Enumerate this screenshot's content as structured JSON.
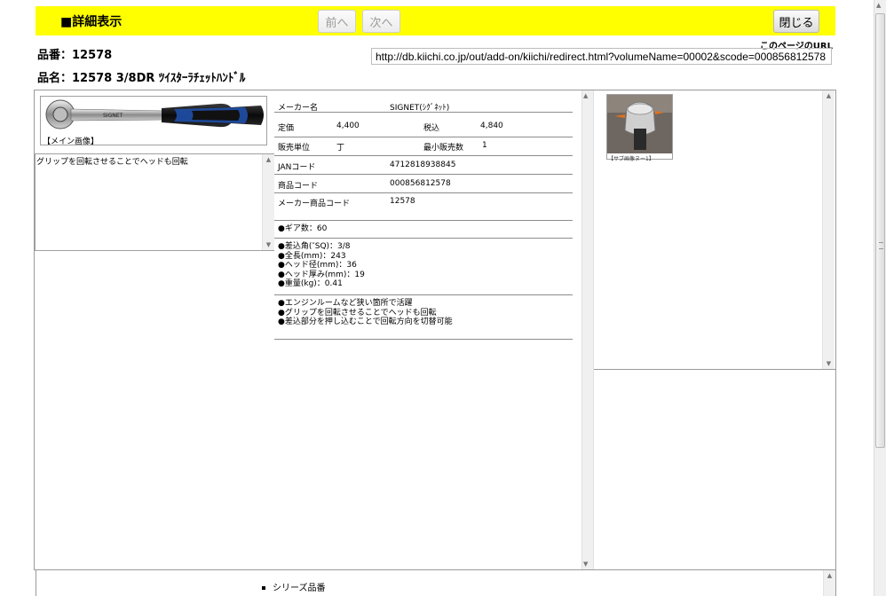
{
  "header": {
    "title": "■詳細表示",
    "prev_label": "前へ",
    "next_label": "次へ",
    "close_label": "閉じる"
  },
  "product": {
    "number_line": "品番：12578",
    "name_line": "品名：12578 3/8DR ﾂｲｽﾀｰﾗﾁｪｯﾄﾊﾝﾄﾞﾙ"
  },
  "page_url": {
    "label": "このページのURL",
    "value": "http://db.kiichi.co.jp/out/add-on/kiichi/redirect.html?volumeName=00002&scode=000856812578"
  },
  "main_image": {
    "caption": "【メイン画像】"
  },
  "description": {
    "text": "グリップを回転させることでヘッドも回転"
  },
  "spec": {
    "maker_label": "メーカー名",
    "maker_value": "SIGNET(ｼｸﾞﾈｯﾄ)",
    "list_price_label": "定価",
    "list_price_value": "4,400",
    "tax_incl_label": "税込",
    "tax_incl_value": "4,840",
    "unit_label": "販売単位",
    "unit_value": "丁",
    "min_qty_label": "最小販売数",
    "min_qty_value": "1",
    "jan_label": "JANコード",
    "jan_value": "4712818938845",
    "product_code_label": "商品コード",
    "product_code_value": "000856812578",
    "maker_code_label": "メーカー商品コード",
    "maker_code_value": "12578"
  },
  "features": {
    "group1": [
      "●ギア数：60"
    ],
    "group2": [
      "●差込角(″SQ)：3/8",
      "●全長(mm)：243",
      "●ヘッド径(mm)：36",
      "●ヘッド厚み(mm)：19",
      "●重量(kg)：0.41"
    ],
    "group3": [
      "●エンジンルームなど狭い箇所で活躍",
      "●グリップを回転させることでヘッドも回転",
      "●差込部分を押し込むことで回転方向を切替可能"
    ]
  },
  "sub_image": {
    "caption": "【サブ画像ヌー1】"
  },
  "series": {
    "label": "シリーズ品番"
  },
  "colors": {
    "header_bg": "#ffff00",
    "grip_blue": "#1f4fa8"
  },
  "icons": [
    "scroll-up-arrow",
    "scroll-down-arrow",
    "ratchet-product-photo",
    "ratchet-head-photo"
  ]
}
